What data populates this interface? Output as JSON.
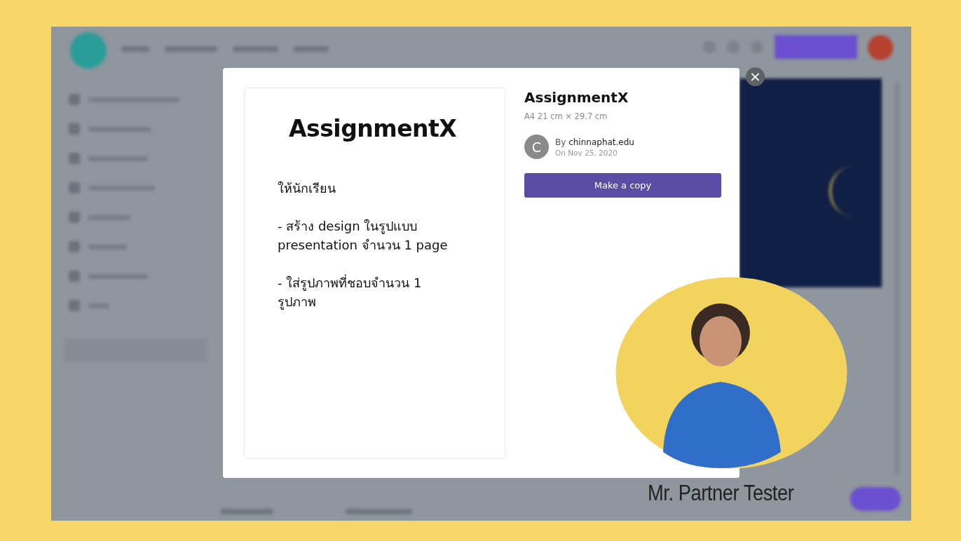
{
  "modal": {
    "preview": {
      "title": "AssignmentX",
      "paragraphs": [
        "ให้นักเรียน",
        "- สร้าง design ในรูปแบบ presentation จำนวน 1 page",
        "- ใส่รูปภาพที่ชอบจำนวน 1 รูปภาพ"
      ]
    },
    "title": "AssignmentX",
    "size": "A4 21 cm × 29.7 cm",
    "author": {
      "initial": "C",
      "by": "By **chinnaphat.edu**",
      "date": "On Nov 25, 2020"
    },
    "button": "Make a copy",
    "close": "×"
  },
  "presenter": {
    "name": "Mr. Partner Tester"
  }
}
